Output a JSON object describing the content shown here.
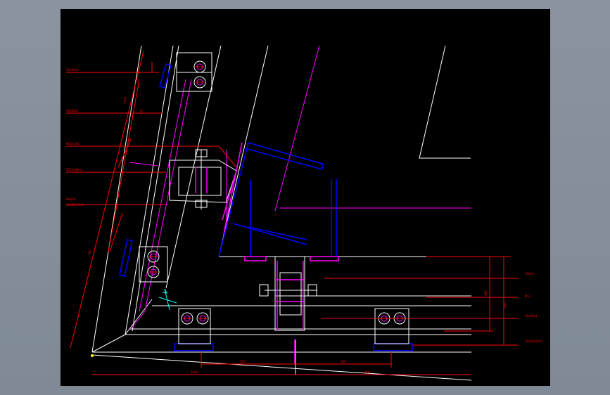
{
  "colors": {
    "background": "#000000",
    "frame": "#ffffff",
    "structure": "#0000ff",
    "detail": "#ff00ff",
    "dimension": "#ff0000",
    "annotation": "#00ffff"
  },
  "annotations_left": [
    {
      "id": "a1",
      "text": "20x30x3"
    },
    {
      "id": "a2",
      "text": "40x60x5"
    },
    {
      "id": "a3",
      "text": "M10x100"
    },
    {
      "id": "a4",
      "text": "ST12x40x4"
    },
    {
      "id": "a5",
      "text": "M8x50"
    },
    {
      "id": "a6",
      "text": "10x50x50x3"
    }
  ],
  "annotations_right": [
    {
      "id": "r1",
      "text": "L50x5"
    },
    {
      "id": "r2",
      "text": "M12"
    },
    {
      "id": "r3",
      "text": "30x60x4"
    },
    {
      "id": "r4",
      "text": "30x40x50x5"
    }
  ],
  "dimensions": {
    "bottom_inner_left": "250",
    "bottom_inner_right": "500",
    "bottom_left": "1400",
    "bottom_right": "1400",
    "right_inner": "180",
    "right_outer": "300",
    "slope_outer": "1400",
    "slope_upper": "250",
    "slope_mid": "500",
    "slope_long": "800"
  }
}
